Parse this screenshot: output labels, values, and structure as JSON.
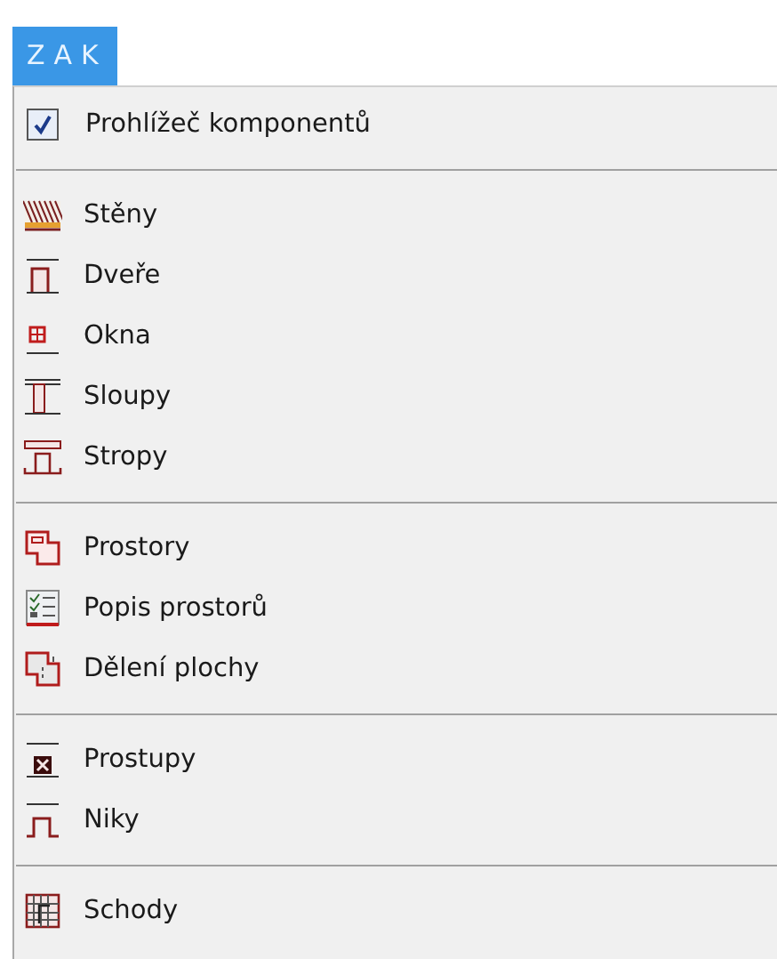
{
  "menu": {
    "title": "ZAK",
    "groups": [
      {
        "items": [
          {
            "kind": "checkbox",
            "label": "Prohlížeč komponentů",
            "checked": true
          }
        ]
      },
      {
        "items": [
          {
            "kind": "walls",
            "label": "Stěny"
          },
          {
            "kind": "door",
            "label": "Dveře"
          },
          {
            "kind": "window",
            "label": "Okna"
          },
          {
            "kind": "column",
            "label": "Sloupy"
          },
          {
            "kind": "slab",
            "label": "Stropy"
          }
        ]
      },
      {
        "items": [
          {
            "kind": "room",
            "label": "Prostory"
          },
          {
            "kind": "list",
            "label": "Popis prostorů"
          },
          {
            "kind": "division",
            "label": "Dělení plochy"
          }
        ]
      },
      {
        "items": [
          {
            "kind": "opening",
            "label": "Prostupy"
          },
          {
            "kind": "niche",
            "label": "Niky"
          }
        ]
      },
      {
        "items": [
          {
            "kind": "stairs",
            "label": "Schody"
          }
        ]
      }
    ]
  }
}
